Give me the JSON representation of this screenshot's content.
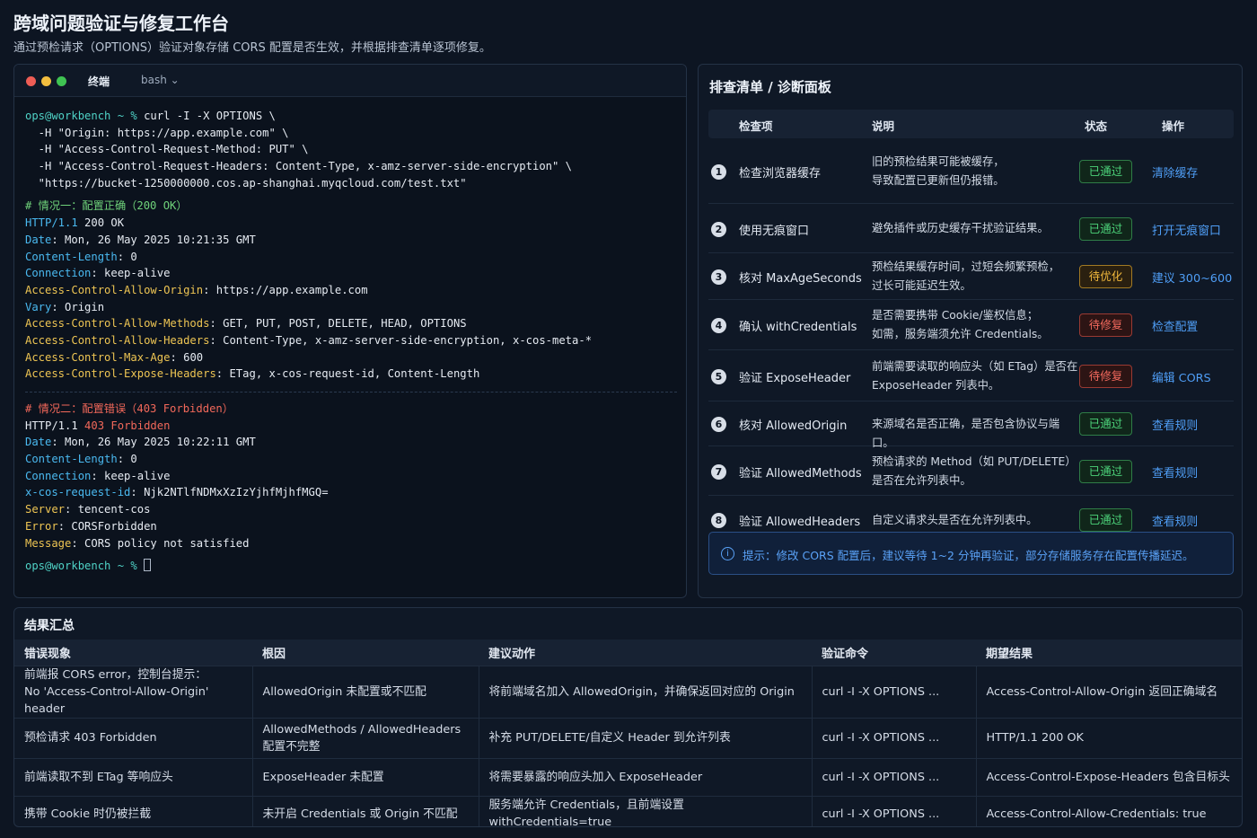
{
  "page": {
    "title": "跨域问题验证与修复工作台",
    "subtitle": "通过预检请求（OPTIONS）验证对象存储 CORS 配置是否生效，并根据排查清单逐项修复。"
  },
  "terminal": {
    "tab_label": "终端",
    "shell": "bash ⌄",
    "lines": [
      {
        "segs": [
          {
            "c": "t-prompt",
            "t": "ops@workbench ~ % "
          },
          {
            "c": "",
            "t": "curl -I -X OPTIONS \\"
          }
        ]
      },
      {
        "segs": [
          {
            "c": "",
            "t": "  -H \"Origin: https://app.example.com\" \\"
          }
        ]
      },
      {
        "segs": [
          {
            "c": "",
            "t": "  -H \"Access-Control-Request-Method: PUT\" \\"
          }
        ]
      },
      {
        "segs": [
          {
            "c": "",
            "t": "  -H \"Access-Control-Request-Headers: Content-Type, x-amz-server-side-encryption\" \\"
          }
        ]
      },
      {
        "segs": [
          {
            "c": "",
            "t": "  \"https://bucket-1250000000.cos.ap-shanghai.myqcloud.com/test.txt\""
          }
        ]
      },
      {
        "gap": true
      },
      {
        "segs": [
          {
            "c": "t-ok",
            "t": "# 情况一：配置正确（200 OK）"
          }
        ]
      },
      {
        "segs": [
          {
            "c": "t-key2",
            "t": "HTTP/1.1"
          },
          {
            "c": "",
            "t": " 200 OK"
          }
        ]
      },
      {
        "segs": [
          {
            "c": "t-key2",
            "t": "Date"
          },
          {
            "c": "",
            "t": ": Mon, 26 May 2025 10:21:35 GMT"
          }
        ]
      },
      {
        "segs": [
          {
            "c": "t-key2",
            "t": "Content-Length"
          },
          {
            "c": "",
            "t": ": 0"
          }
        ]
      },
      {
        "segs": [
          {
            "c": "t-key2",
            "t": "Connection"
          },
          {
            "c": "",
            "t": ": keep-alive"
          }
        ]
      },
      {
        "segs": [
          {
            "c": "t-key",
            "t": "Access-Control-Allow-Origin"
          },
          {
            "c": "",
            "t": ": https://app.example.com"
          }
        ]
      },
      {
        "segs": [
          {
            "c": "t-key2",
            "t": "Vary"
          },
          {
            "c": "",
            "t": ": Origin"
          }
        ]
      },
      {
        "segs": [
          {
            "c": "t-key",
            "t": "Access-Control-Allow-Methods"
          },
          {
            "c": "",
            "t": ": GET, PUT, POST, DELETE, HEAD, OPTIONS"
          }
        ]
      },
      {
        "segs": [
          {
            "c": "t-key",
            "t": "Access-Control-Allow-Headers"
          },
          {
            "c": "",
            "t": ": Content-Type, x-amz-server-side-encryption, x-cos-meta-*"
          }
        ]
      },
      {
        "segs": [
          {
            "c": "t-key",
            "t": "Access-Control-Max-Age"
          },
          {
            "c": "",
            "t": ": 600"
          }
        ]
      },
      {
        "segs": [
          {
            "c": "t-key",
            "t": "Access-Control-Expose-Headers"
          },
          {
            "c": "",
            "t": ": ETag, x-cos-request-id, Content-Length"
          }
        ]
      },
      {
        "divider": true
      },
      {
        "segs": [
          {
            "c": "t-err",
            "t": "# 情况二：配置错误（403 Forbidden）"
          }
        ]
      },
      {
        "segs": [
          {
            "c": "",
            "t": "HTTP/1.1 "
          },
          {
            "c": "t-err",
            "t": "403 Forbidden"
          }
        ]
      },
      {
        "segs": [
          {
            "c": "t-key2",
            "t": "Date"
          },
          {
            "c": "",
            "t": ": Mon, 26 May 2025 10:22:11 GMT"
          }
        ]
      },
      {
        "segs": [
          {
            "c": "t-key2",
            "t": "Content-Length"
          },
          {
            "c": "",
            "t": ": 0"
          }
        ]
      },
      {
        "segs": [
          {
            "c": "t-key2",
            "t": "Connection"
          },
          {
            "c": "",
            "t": ": keep-alive"
          }
        ]
      },
      {
        "segs": [
          {
            "c": "t-key2",
            "t": "x-cos-request-id"
          },
          {
            "c": "",
            "t": ": Njk2NTlfNDMxXzIzYjhfMjhfMGQ="
          }
        ]
      },
      {
        "segs": [
          {
            "c": "t-key",
            "t": "Server"
          },
          {
            "c": "",
            "t": ": tencent-cos"
          }
        ]
      },
      {
        "segs": [
          {
            "c": "t-key",
            "t": "Error"
          },
          {
            "c": "",
            "t": ": CORSForbidden"
          }
        ]
      },
      {
        "segs": [
          {
            "c": "t-key",
            "t": "Message"
          },
          {
            "c": "",
            "t": ": CORS policy not satisfied"
          }
        ]
      },
      {
        "gap": true
      },
      {
        "prompt": true,
        "segs": [
          {
            "c": "t-prompt",
            "t": "ops@workbench ~ % "
          }
        ]
      }
    ]
  },
  "checklist": {
    "title": "排查清单 / 诊断面板",
    "headers": {
      "item": "检查项",
      "desc": "说明",
      "status": "状态",
      "action": "操作"
    },
    "rows": [
      {
        "num": "1",
        "item": "检查浏览器缓存",
        "desc": "旧的预检结果可能被缓存，\n导致配置已更新但仍报错。",
        "status": "已通过",
        "level": "pass",
        "action": "清除缓存"
      },
      {
        "num": "2",
        "item": "使用无痕窗口",
        "desc": "避免插件或历史缓存干扰验证结果。",
        "status": "已通过",
        "level": "pass",
        "action": "打开无痕窗口"
      },
      {
        "num": "3",
        "item": "核对 MaxAgeSeconds",
        "desc": "预检结果缓存时间，过短会频繁预检，\n过长可能延迟生效。",
        "status": "待优化",
        "level": "opt",
        "action": "建议 300~600"
      },
      {
        "num": "4",
        "item": "确认 withCredentials",
        "desc": "是否需要携带 Cookie/鉴权信息；\n如需，服务端须允许 Credentials。",
        "status": "待修复",
        "level": "fix",
        "action": "检查配置"
      },
      {
        "num": "5",
        "item": "验证 ExposeHeader",
        "desc": "前端需要读取的响应头（如 ETag）是否在\nExposeHeader 列表中。",
        "status": "待修复",
        "level": "fix",
        "action": "编辑 CORS"
      },
      {
        "num": "6",
        "item": "核对 AllowedOrigin",
        "desc": "来源域名是否正确，是否包含协议与端口。",
        "status": "已通过",
        "level": "pass",
        "action": "查看规则"
      },
      {
        "num": "7",
        "item": "验证 AllowedMethods",
        "desc": "预检请求的 Method（如 PUT/DELETE）\n是否在允许列表中。",
        "status": "已通过",
        "level": "pass",
        "action": "查看规则"
      },
      {
        "num": "8",
        "item": "验证 AllowedHeaders",
        "desc": "自定义请求头是否在允许列表中。",
        "status": "已通过",
        "level": "pass",
        "action": "查看规则"
      }
    ],
    "tip": "提示：修改 CORS 配置后，建议等待 1~2 分钟再验证，部分存储服务存在配置传播延迟。"
  },
  "summary": {
    "title": "结果汇总",
    "headers": [
      "错误现象",
      "根因",
      "建议动作",
      "验证命令",
      "期望结果"
    ],
    "rows": [
      [
        "前端报 CORS error，控制台提示：\nNo 'Access-Control-Allow-Origin' header",
        "AllowedOrigin 未配置或不匹配",
        "将前端域名加入 AllowedOrigin，并确保返回对应的 Origin",
        "curl -I -X OPTIONS ...",
        "Access-Control-Allow-Origin 返回正确域名"
      ],
      [
        "预检请求 403 Forbidden",
        "AllowedMethods / AllowedHeaders\n配置不完整",
        "补充 PUT/DELETE/自定义 Header 到允许列表",
        "curl -I -X OPTIONS ...",
        "HTTP/1.1 200 OK"
      ],
      [
        "前端读取不到 ETag 等响应头",
        "ExposeHeader 未配置",
        "将需要暴露的响应头加入 ExposeHeader",
        "curl -I -X OPTIONS ...",
        "Access-Control-Expose-Headers 包含目标头"
      ],
      [
        "携带 Cookie 时仍被拦截",
        "未开启 Credentials 或 Origin 不匹配",
        "服务端允许 Credentials，且前端设置 withCredentials=true",
        "curl -I -X OPTIONS ...",
        "Access-Control-Allow-Credentials: true"
      ]
    ]
  }
}
